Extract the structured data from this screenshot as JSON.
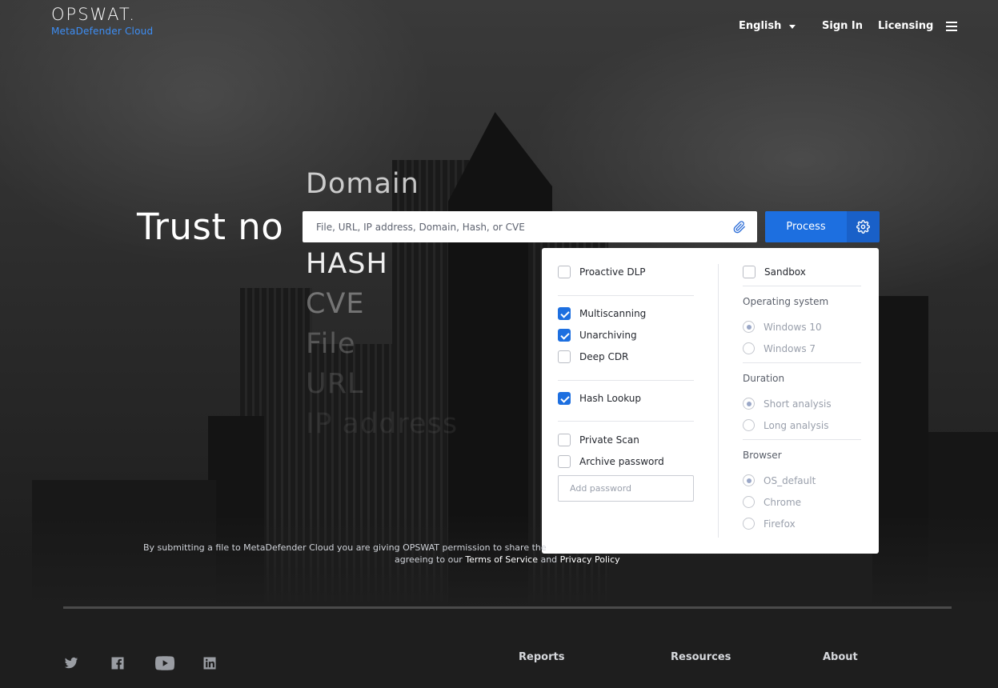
{
  "brand": {
    "name": "OPSWAT.",
    "product": "MetaDefender Cloud",
    "accent": "#3d8ef5"
  },
  "nav": {
    "language": "English",
    "sign_in": "Sign In",
    "licensing": "Licensing"
  },
  "hero": {
    "title": "Trust no",
    "rotating_words": [
      "Domain",
      "HASH",
      "CVE",
      "File",
      "URL",
      "IP address"
    ]
  },
  "search": {
    "placeholder": "File, URL, IP address, Domain, Hash, or CVE",
    "process_label": "Process"
  },
  "panel": {
    "left": {
      "proactive_dlp": {
        "label": "Proactive DLP",
        "checked": false
      },
      "multiscanning": {
        "label": "Multiscanning",
        "checked": true
      },
      "unarchiving": {
        "label": "Unarchiving",
        "checked": true
      },
      "deep_cdr": {
        "label": "Deep CDR",
        "checked": false
      },
      "hash_lookup": {
        "label": "Hash Lookup",
        "checked": true
      },
      "private_scan": {
        "label": "Private Scan",
        "checked": false
      },
      "archive_password": {
        "label": "Archive password",
        "checked": false
      },
      "password_placeholder": "Add password"
    },
    "right": {
      "sandbox": {
        "label": "Sandbox",
        "checked": false
      },
      "os_title": "Operating system",
      "os_options": [
        "Windows 10",
        "Windows 7"
      ],
      "os_selected": "Windows 10",
      "duration_title": "Duration",
      "duration_options": [
        "Short analysis",
        "Long analysis"
      ],
      "duration_selected": "Short analysis",
      "browser_title": "Browser",
      "browser_options": [
        "OS_default",
        "Chrome",
        "Firefox"
      ],
      "browser_selected": "OS_default"
    }
  },
  "disclaimer": {
    "line1": "By submitting a file to MetaDefender Cloud you are giving OPSWAT permission to share the",
    "line2_prefix": "agreeing to our",
    "terms": "Terms of Service",
    "and": "and",
    "privacy": "Privacy Policy"
  },
  "footer": {
    "social": [
      "twitter-icon",
      "facebook-icon",
      "youtube-icon",
      "linkedin-icon"
    ],
    "columns": [
      "Reports",
      "Resources",
      "About"
    ]
  },
  "colors": {
    "primary_button": "#1d6fe0",
    "gear_button": "#1960c8"
  }
}
